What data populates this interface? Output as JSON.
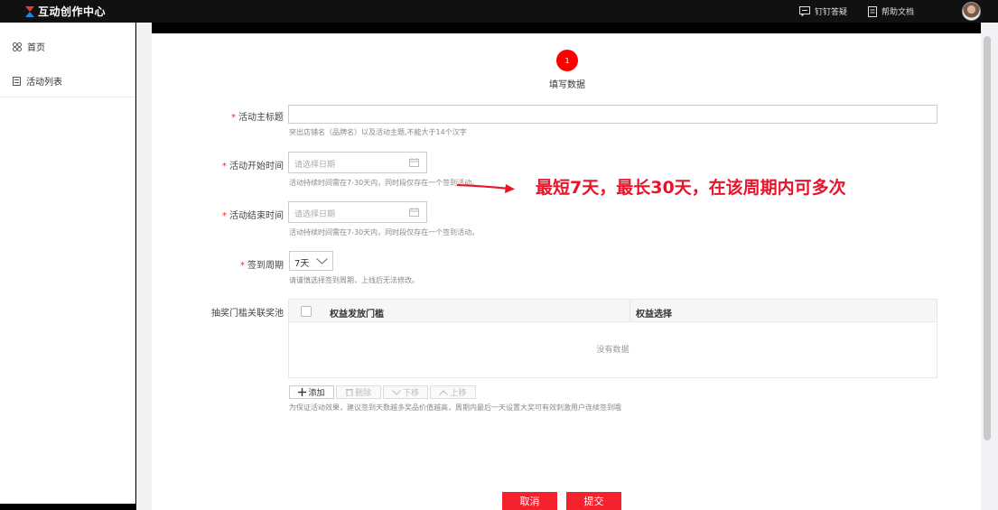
{
  "topbar": {
    "app_title": "互动创作中心",
    "links": [
      {
        "label": "钉钉答疑",
        "icon": "chat-bubble-icon"
      },
      {
        "label": "帮助文档",
        "icon": "document-icon"
      }
    ],
    "avatar": "user-avatar"
  },
  "sidebar": {
    "items": [
      {
        "label": "首页",
        "icon": "grid-icon"
      },
      {
        "label": "活动列表",
        "icon": "list-icon"
      }
    ]
  },
  "steps": {
    "current_number": "1",
    "current_label": "填写数据"
  },
  "form": {
    "title": {
      "label": "活动主标题",
      "value": "",
      "hint": "突出店铺名（品牌名）以及活动主题,不能大于14个汉字"
    },
    "start_time": {
      "label": "活动开始时间",
      "placeholder": "请选择日期",
      "hint": "活动持续时间需在7-30天内，同时段仅存在一个签到活动。"
    },
    "end_time": {
      "label": "活动结束时间",
      "placeholder": "请选择日期",
      "hint": "活动持续时间需在7-30天内，同时段仅存在一个签到活动。"
    },
    "cycle": {
      "label": "签到周期",
      "value": "7天",
      "hint": "请谨慎选择签到周期，上线后无法修改。"
    },
    "prize_pool": {
      "label": "抽奖门槛关联奖池",
      "columns": [
        "权益发放门槛",
        "权益选择"
      ],
      "empty_text": "没有数据",
      "buttons": {
        "add": "添加",
        "delete": "删除",
        "move_down": "下移",
        "move_up": "上移"
      },
      "hint": "为保证活动效果，建议签到天数越多奖品价值越高，周期内最后一天设置大奖可有效刺激用户连续签到哦"
    }
  },
  "actions": {
    "cancel": "取消",
    "submit": "提交"
  },
  "annotation": {
    "text": "最短7天，最长30天，在该周期内可多次"
  },
  "colors": {
    "accent_red": "#f5222d",
    "annotation_red": "#e8152a",
    "topbar_bg": "#111111"
  }
}
